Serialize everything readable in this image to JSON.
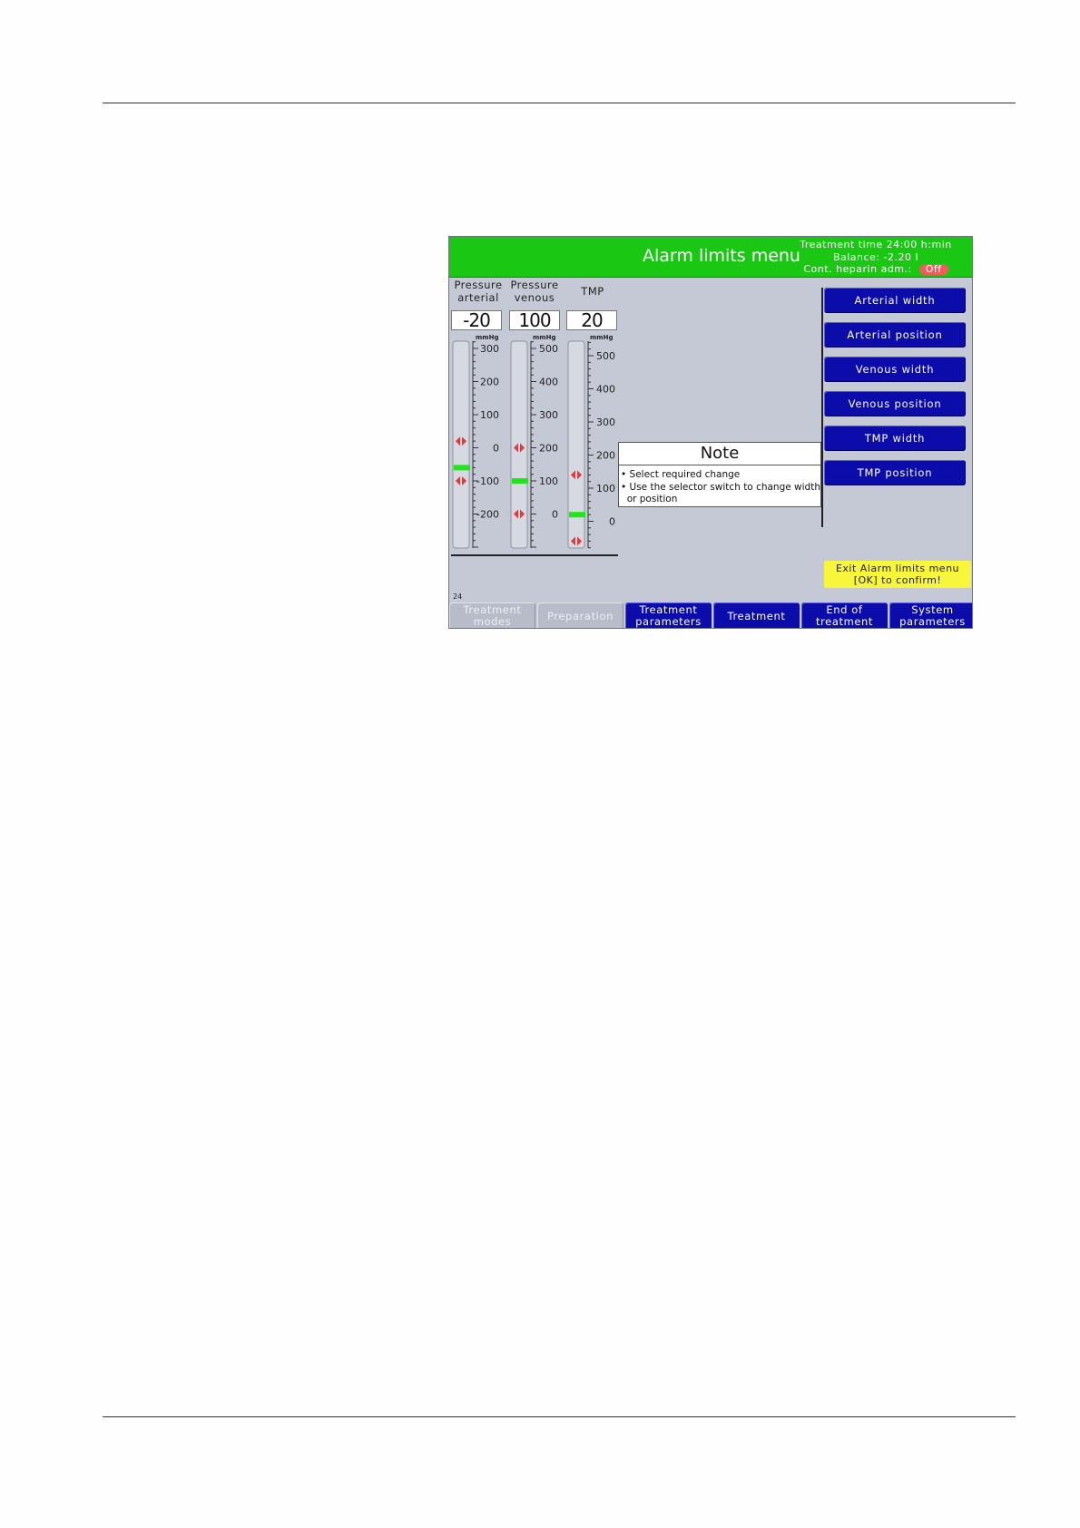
{
  "header": {
    "title": "Alarm limits menu",
    "treatment_time": "Treatment time 24:00 h:min",
    "balance": "Balance: -2.20 l",
    "heparin": "Cont. heparin adm.:",
    "heparin_status": "Off"
  },
  "gauges": [
    {
      "label_line1": "Pressure",
      "label_line2": "arterial",
      "value": "-20",
      "unit": "mmHg",
      "ticks": [
        "300",
        "200",
        "100",
        "0",
        "-100",
        "-200"
      ],
      "current_value": -60,
      "limit_upper": 20,
      "limit_lower": -100
    },
    {
      "label_line1": "Pressure",
      "label_line2": "venous",
      "value": "100",
      "unit": "mmHg",
      "ticks": [
        "500",
        "400",
        "300",
        "200",
        "100",
        "0"
      ],
      "current_value": 100,
      "limit_upper": 200,
      "limit_lower": 0
    },
    {
      "label_line1": "",
      "label_line2": "TMP",
      "value": "20",
      "unit": "mmHg",
      "ticks": [
        "500",
        "400",
        "300",
        "200",
        "100",
        "0"
      ],
      "current_value": 20,
      "limit_upper": 140,
      "limit_lower": -60
    }
  ],
  "note": {
    "title": "Note",
    "line1": "Select required change",
    "line2": "Use the selector switch to change width",
    "line3": "or position"
  },
  "side_menu": [
    {
      "label": "Arterial width",
      "active": true
    },
    {
      "label": "Arterial position",
      "active": false
    },
    {
      "label": "Venous width",
      "active": false
    },
    {
      "label": "Venous position",
      "active": false
    },
    {
      "label": "TMP width",
      "active": false
    },
    {
      "label": "TMP position",
      "active": false
    }
  ],
  "exit": {
    "line1": "Exit Alarm limits menu",
    "line2": "[OK] to confirm!"
  },
  "page_number": "24",
  "tabs": [
    {
      "line1": "Treatment",
      "line2": "modes",
      "disabled": true
    },
    {
      "line1": "Preparation",
      "line2": "",
      "disabled": true
    },
    {
      "line1": "Treatment",
      "line2": "parameters",
      "disabled": false
    },
    {
      "line1": "Treatment",
      "line2": "",
      "disabled": false
    },
    {
      "line1": "End of",
      "line2": "treatment",
      "disabled": false
    },
    {
      "line1": "System",
      "line2": "parameters",
      "disabled": false
    }
  ],
  "colors": {
    "header_green": "#1ac814",
    "button_blue": "#0c0cab",
    "active_green": "#1ad914",
    "exit_yellow": "#f8f63a",
    "limit_marker_red": "#e23a3a",
    "value_marker_green": "#1ee61a"
  }
}
